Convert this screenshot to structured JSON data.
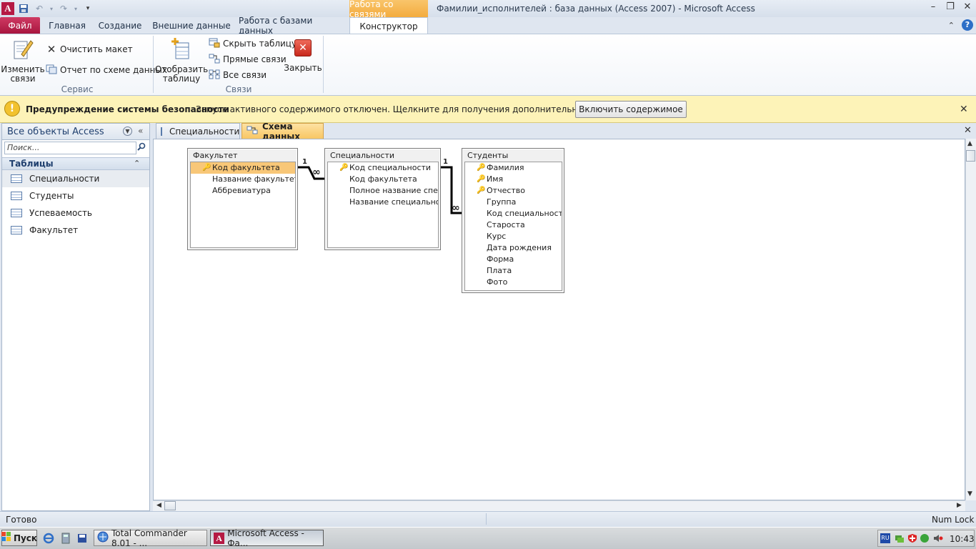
{
  "app": {
    "window_title": "Фамилии_исполнителей : база данных (Access 2007)  -  Microsoft Access",
    "contextual_group": "Работа со связями"
  },
  "ribbon_tabs": {
    "file": "Файл",
    "home": "Главная",
    "create": "Создание",
    "external": "Внешние данные",
    "dbtools": "Работа с базами данных",
    "design": "Конструктор"
  },
  "ribbon": {
    "edit_relationships_l1": "Изменить",
    "edit_relationships_l2": "связи",
    "clear_layout": "Очистить макет",
    "relationship_report": "Отчет по схеме данных",
    "group_service": "Сервис",
    "show_table_l1": "Отобразить",
    "show_table_l2": "таблицу",
    "hide_table": "Скрыть таблицу",
    "direct_relationships": "Прямые связи",
    "all_relationships": "Все связи",
    "close": "Закрыть",
    "group_relationships": "Связи"
  },
  "security": {
    "title": "Предупреждение системы безопасности",
    "message": "Запуск активного содержимого отключен. Щелкните для получения дополнительных сведений.",
    "enable_button": "Включить содержимое"
  },
  "nav": {
    "title": "Все объекты Access",
    "search_placeholder": "Поиск...",
    "group": "Таблицы",
    "items": [
      "Специальности",
      "Студенты",
      "Успеваемость",
      "Факультет"
    ]
  },
  "doc_tabs": [
    "Специальности",
    "Схема данных"
  ],
  "tables": {
    "faculty": {
      "title": "Факультет",
      "fields": [
        "Код факультета",
        "Название факультета",
        "Аббревиатура"
      ]
    },
    "specialty": {
      "title": "Специальности",
      "fields": [
        "Код специальности",
        "Код факультета",
        "Полное название специальности",
        "Название специальности"
      ]
    },
    "students": {
      "title": "Студенты",
      "fields": [
        "Фамилия",
        "Имя",
        "Отчество",
        "Группа",
        "Код специальности",
        "Староста",
        "Курс",
        "Дата рождения",
        "Форма",
        "Плата",
        "Фото"
      ]
    }
  },
  "relations": {
    "one": "1",
    "many": "∞"
  },
  "status": {
    "text": "Готово",
    "numlock": "Num Lock"
  },
  "taskbar": {
    "start": "Пуск",
    "task1": "Total Commander 8.01 - ...",
    "task2": "Microsoft Access - Фа...",
    "lang": "RU",
    "clock": "10:43"
  }
}
